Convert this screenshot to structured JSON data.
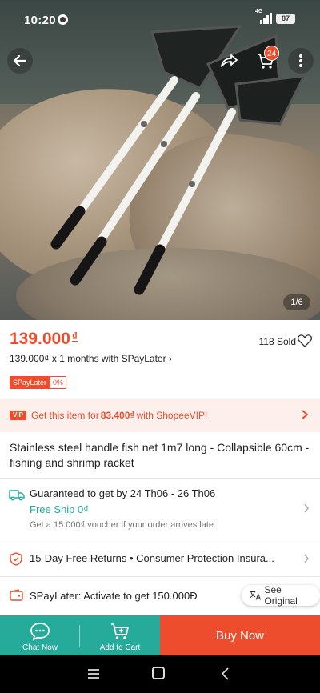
{
  "status_bar": {
    "time": "10:20",
    "network": "4G",
    "battery": "87"
  },
  "top_bar": {
    "cart_count": "24"
  },
  "gallery": {
    "counter": "1/6"
  },
  "product": {
    "price": "139.000",
    "currency_symbol": "₫",
    "sold": "118 Sold",
    "installment": "139.000₫ x 1 months with SPayLater",
    "spaylater_tag": "SPayLater",
    "spaylater_rate": "0%",
    "title": "Stainless steel handle fish net 1m7 long - Collapsible 60cm - fishing and shrimp racket"
  },
  "vip": {
    "badge": "VIP",
    "text_prefix": "Get this item for ",
    "vip_price": "83.400₫",
    "text_suffix": " with ShopeeVIP!"
  },
  "shipping": {
    "guarantee": "Guaranteed to get by 24 Th06 - 26 Th06",
    "free_ship": "Free Ship 0₫",
    "voucher": "Get a 15.000₫ voucher if your order arrives late."
  },
  "returns": {
    "text": "15-Day Free Returns  •  Consumer Protection Insura..."
  },
  "spaylater_row": {
    "text": "SPayLater: Activate to get 150.000Đ"
  },
  "translate": {
    "label": "See Original"
  },
  "actions": {
    "chat": "Chat Now",
    "add_to_cart": "Add to Cart",
    "buy": "Buy Now"
  },
  "colors": {
    "brand": "#ee4d2d",
    "teal": "#26aa99"
  }
}
